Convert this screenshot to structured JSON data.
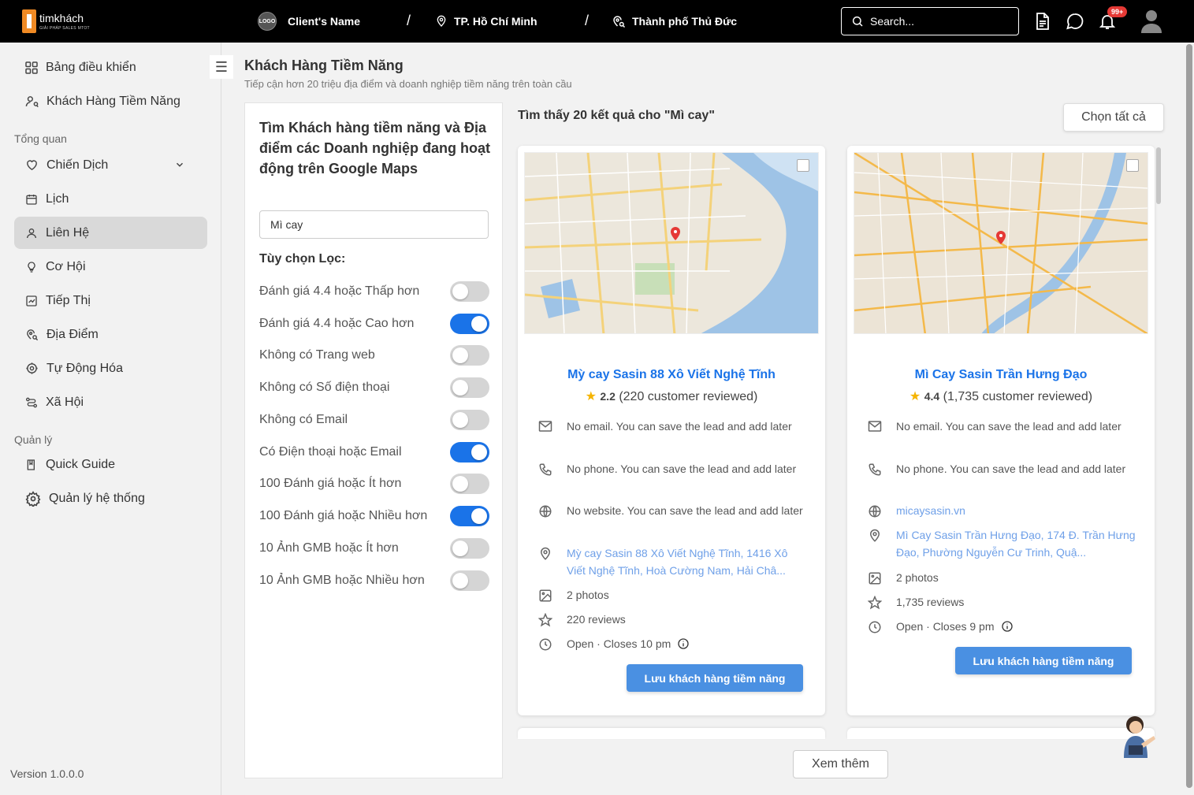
{
  "header": {
    "logo_name": "timkhách",
    "logo_tagline": "GIẢI PHÁP SALES MTOT",
    "client_logo": "LOGO",
    "client_name": "Client's Name",
    "separator": "/",
    "city": "TP. Hồ Chí Minh",
    "district": "Thành phố Thủ Đức",
    "search_placeholder": "Search...",
    "notification_count": "99+"
  },
  "sidebar": {
    "top_items": [
      {
        "label": "Bảng điều khiển",
        "icon": "grid-icon"
      },
      {
        "label": "Khách Hàng Tiềm Năng",
        "icon": "user-search-icon"
      }
    ],
    "section_overview": "Tổng quan",
    "overview_items": [
      {
        "label": "Chiến Dịch",
        "icon": "heart-icon"
      },
      {
        "label": "Lịch",
        "icon": "calendar-icon"
      },
      {
        "label": "Liên Hệ",
        "icon": "user-icon"
      },
      {
        "label": "Cơ Hội",
        "icon": "lightbulb-icon"
      },
      {
        "label": "Tiếp Thị",
        "icon": "chart-icon"
      },
      {
        "label": "Địa Điểm",
        "icon": "location-icon"
      },
      {
        "label": "Tự Động Hóa",
        "icon": "automation-icon"
      },
      {
        "label": "Xã Hội",
        "icon": "share-icon"
      }
    ],
    "section_manage": "Quản lý",
    "manage_items": [
      {
        "label": "Quick Guide",
        "icon": "book-icon"
      },
      {
        "label": "Quản lý hệ thống",
        "icon": "gear-icon"
      }
    ],
    "version": "Version 1.0.0.0"
  },
  "page": {
    "title": "Khách Hàng Tiềm Năng",
    "subtitle": "Tiếp cận hơn 20 triệu địa điểm và doanh nghiệp tiềm năng trên toàn cầu"
  },
  "filters": {
    "title": "Tìm Khách hàng tiềm năng và Địa điểm các Doanh nghiệp đang hoạt động trên Google Maps",
    "search_value": "Mì cay",
    "options_label": "Tùy chọn Lọc:",
    "toggles": [
      {
        "label": "Đánh giá 4.4 hoặc Thấp hơn",
        "on": false
      },
      {
        "label": "Đánh giá 4.4 hoặc Cao hơn",
        "on": true
      },
      {
        "label": "Không có Trang web",
        "on": false
      },
      {
        "label": "Không có Số điện thoại",
        "on": false
      },
      {
        "label": "Không có Email",
        "on": false
      },
      {
        "label": "Có Điện thoại hoặc Email",
        "on": true
      },
      {
        "label": "100 Đánh giá hoặc Ít hơn",
        "on": false
      },
      {
        "label": "100 Đánh giá hoặc Nhiều hơn",
        "on": true
      },
      {
        "label": "10 Ảnh GMB hoặc Ít hơn",
        "on": false
      },
      {
        "label": "10 Ảnh GMB hoặc Nhiều hơn",
        "on": false
      }
    ]
  },
  "results": {
    "summary": "Tìm thấy 20 kết quả cho \"Mì cay\"",
    "select_all": "Chọn tất cả",
    "load_more": "Xem thêm",
    "cards": [
      {
        "name": "Mỳ cay Sasin 88 Xô Viết Nghệ Tĩnh",
        "rating": "2.2",
        "reviews_text": "(220 customer reviewed)",
        "email": "No email. You can save the lead and add later",
        "phone": "No phone. You can save the lead and add later",
        "website": "No website. You can save the lead and add later",
        "address": "Mỳ cay Sasin 88 Xô Viết Nghệ Tĩnh, 1416 Xô Viết Nghệ Tĩnh, Hoà Cường Nam, Hải Châ...",
        "photos": "2 photos",
        "reviews": "220 reviews",
        "hours": "Open · Closes 10 pm",
        "save_label": "Lưu khách hàng tiềm năng"
      },
      {
        "name": "Mì Cay Sasin Trần Hưng Đạo",
        "rating": "4.4",
        "reviews_text": "(1,735 customer reviewed)",
        "email": "No email. You can save the lead and add later",
        "phone": "No phone. You can save the lead and add later",
        "website": "micaysasin.vn",
        "address": "Mì Cay Sasin Trần Hưng Đạo, 174 Đ. Trần Hưng Đạo, Phường Nguyễn Cư Trinh, Quậ...",
        "photos": "2 photos",
        "reviews": "1,735 reviews",
        "hours": "Open · Closes 9 pm",
        "save_label": "Lưu khách hàng tiềm năng"
      }
    ]
  },
  "colors": {
    "accent": "#1a73e8",
    "button": "#4a90e2",
    "topbar": "#000000",
    "link": "#6fa0e8"
  }
}
